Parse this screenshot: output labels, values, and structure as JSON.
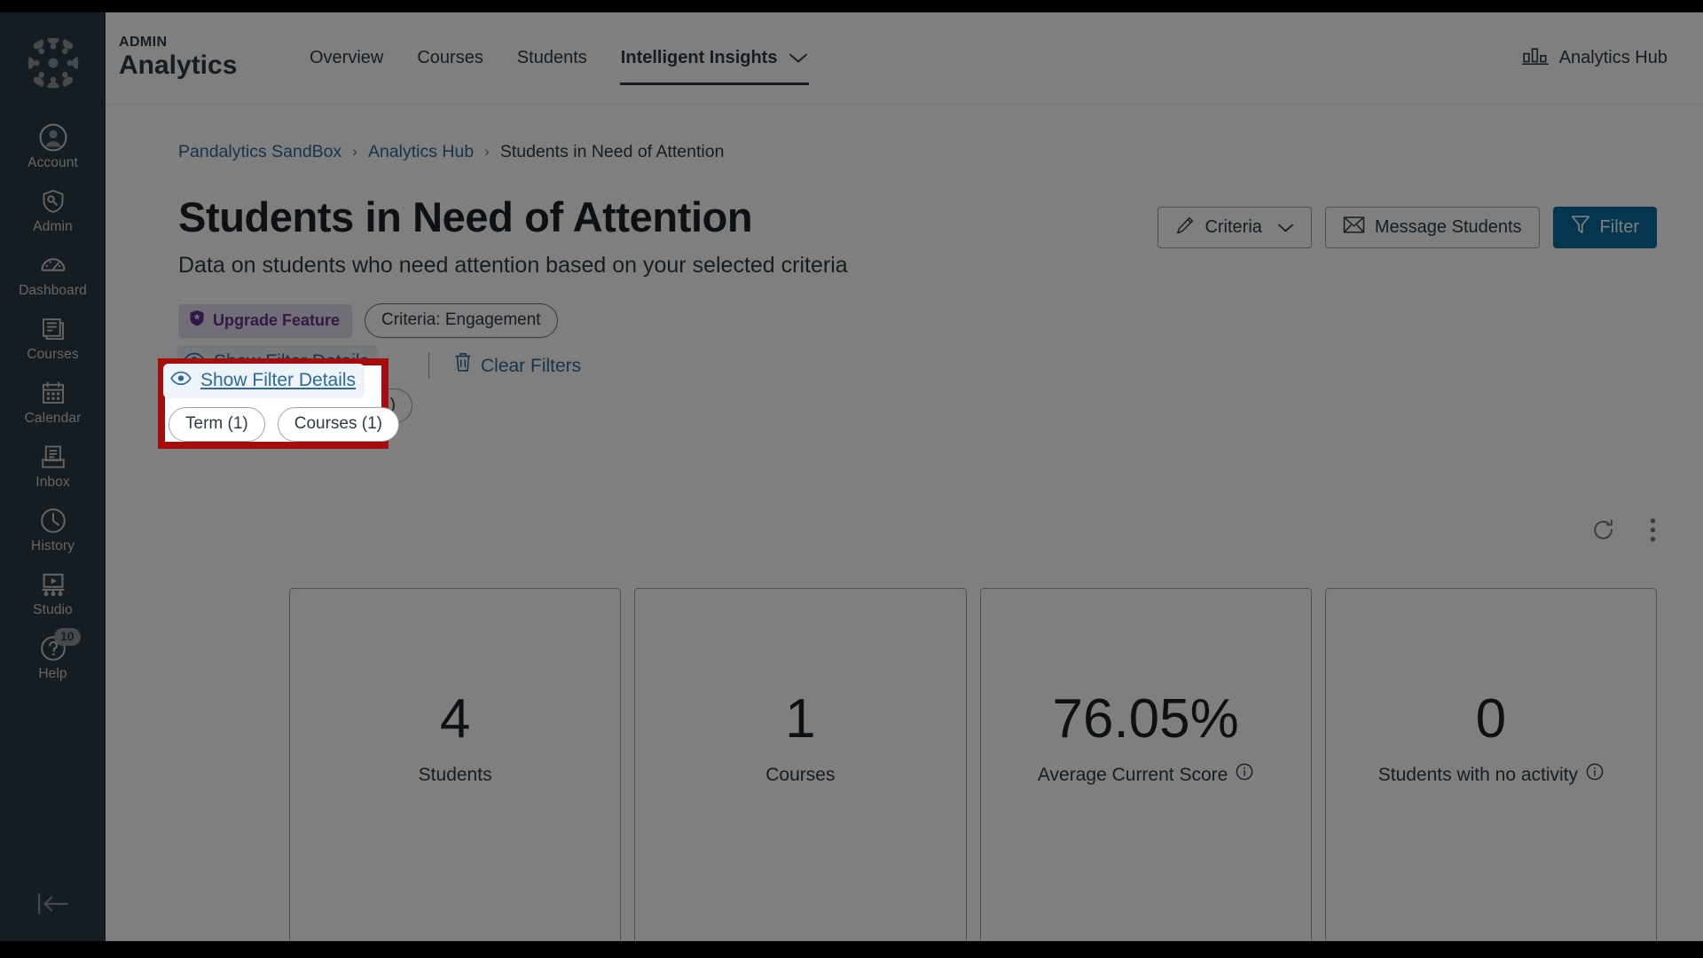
{
  "global_nav": {
    "logo": "canvas-logo",
    "items": [
      {
        "label": "Account",
        "icon": "user-circle-icon"
      },
      {
        "label": "Admin",
        "icon": "shield-wrench-icon"
      },
      {
        "label": "Dashboard",
        "icon": "gauge-icon"
      },
      {
        "label": "Courses",
        "icon": "book-icon"
      },
      {
        "label": "Calendar",
        "icon": "calendar-icon"
      },
      {
        "label": "Inbox",
        "icon": "inbox-icon"
      },
      {
        "label": "History",
        "icon": "clock-icon"
      },
      {
        "label": "Studio",
        "icon": "studio-icon"
      },
      {
        "label": "Help",
        "icon": "question-circle-icon",
        "badge": "10"
      }
    ],
    "collapse_icon": "collapse-left-icon"
  },
  "header": {
    "eyebrow": "ADMIN",
    "title": "Analytics",
    "nav": [
      {
        "label": "Overview",
        "active": false
      },
      {
        "label": "Courses",
        "active": false
      },
      {
        "label": "Students",
        "active": false
      },
      {
        "label": "Intelligent Insights",
        "active": true,
        "icon": "chevron-down-icon"
      }
    ],
    "hub_link": {
      "label": "Analytics Hub",
      "icon": "bar-chart-icon"
    }
  },
  "breadcrumb": {
    "items": [
      {
        "label": "Pandalytics SandBox",
        "link": true
      },
      {
        "label": "Analytics Hub",
        "link": true
      },
      {
        "label": "Students in Need of Attention",
        "link": false
      }
    ],
    "separator": "›"
  },
  "page": {
    "title": "Students in Need of Attention",
    "subtitle": "Data on students who need attention based on your selected criteria"
  },
  "actions": {
    "criteria": {
      "label": "Criteria",
      "icon": "pencil-icon",
      "chevron": "chevron-down-icon"
    },
    "message_students": {
      "label": "Message Students",
      "icon": "envelope-icon"
    },
    "filter": {
      "label": "Filter",
      "icon": "funnel-icon"
    }
  },
  "tags": {
    "upgrade": {
      "label": "Upgrade Feature",
      "icon": "shield-star-icon"
    },
    "criteria_pill": "Criteria: Engagement"
  },
  "filters": {
    "show_details": {
      "label": "Show Filter Details",
      "icon": "eye-icon"
    },
    "clear": {
      "label": "Clear Filters",
      "icon": "trash-icon"
    },
    "pills": [
      {
        "label": "Term (1)"
      },
      {
        "label": "Courses (1)"
      }
    ]
  },
  "card_toolbar": {
    "refresh": "refresh-icon",
    "more": "kebab-menu-icon"
  },
  "stats": [
    {
      "value": "4",
      "label": "Students",
      "info": false
    },
    {
      "value": "1",
      "label": "Courses",
      "info": false
    },
    {
      "value": "76.05%",
      "label": "Average Current Score",
      "info": true
    },
    {
      "value": "0",
      "label": "Students with no activity",
      "info": true
    }
  ],
  "colors": {
    "nav_bg": "#2d3b45",
    "link": "#2b6a9b",
    "primary_button": "#0b6ca1",
    "upgrade_badge_bg": "#e5dcf0",
    "upgrade_badge_text": "#66338b",
    "callout_border": "#a50c0c"
  }
}
